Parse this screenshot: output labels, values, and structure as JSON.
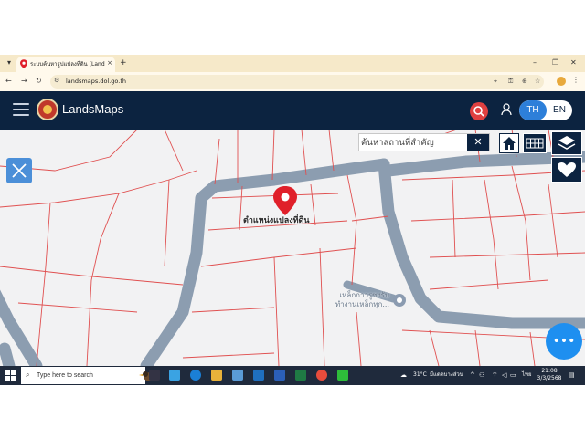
{
  "browser": {
    "tab_title": "ระบบค้นหารูปแปลงที่ดิน (LandsMap",
    "new_tab_glyph": "+",
    "close_glyph": "×",
    "url": "landsmaps.dol.go.th",
    "window_controls": {
      "minimize": "–",
      "restore": "❐",
      "close": "✕"
    }
  },
  "app": {
    "title": "LandsMaps",
    "lang_th": "TH",
    "lang_en": "EN",
    "active_lang": "TH"
  },
  "map": {
    "search": {
      "placeholder": "ค้นหาสถานที่สำคัญ",
      "value": "",
      "clear_glyph": "✕"
    },
    "parcel_label": "ตำแหน่งแปลงที่ดิน",
    "poi_label": "เหล็กกาวรูซงรับ ทำงานเหล็กทุก...",
    "fab_glyph": "•••"
  },
  "taskbar": {
    "search_placeholder": "Type here to search",
    "weather_temp": "31°C",
    "weather_text": "มีแดดบางส่วน",
    "language": "ไทย",
    "time": "21:08",
    "date": "3/3/2568"
  },
  "colors": {
    "appbar": "#0c2340",
    "lang_active": "#2d7fd9",
    "road": "#8c9db0",
    "parcel_line": "#e05050",
    "marker": "#e0202a",
    "fab": "#1e8ff0",
    "tab_strip": "#f6e9c9"
  },
  "icons": {
    "tools": "ruler-pencil-icon",
    "search": "search-icon",
    "user": "user-icon",
    "home": "home-icon",
    "grid": "grid-icon",
    "layers": "layers-icon",
    "favorite": "heart-icon",
    "marker": "map-pin-icon"
  }
}
